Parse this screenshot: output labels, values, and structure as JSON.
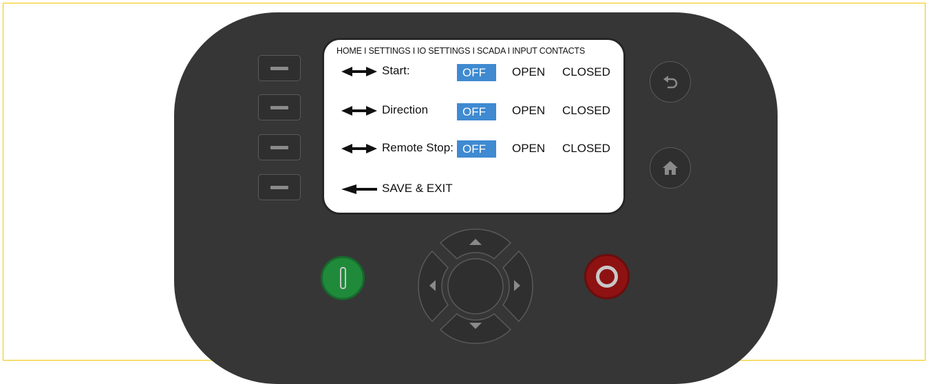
{
  "breadcrumb": "HOME I SETTINGS I IO SETTINGS I SCADA I INPUT CONTACTS",
  "rows": [
    {
      "label": "Start:",
      "options": [
        "OFF",
        "OPEN",
        "CLOSED"
      ],
      "selected": "OFF"
    },
    {
      "label": "Direction",
      "options": [
        "OFF",
        "OPEN",
        "CLOSED"
      ],
      "selected": "OFF"
    },
    {
      "label": "Remote Stop:",
      "options": [
        "OFF",
        "OPEN",
        "CLOSED"
      ],
      "selected": "OFF"
    }
  ],
  "save_exit": "SAVE & EXIT",
  "icons": {
    "back": "back-arrow-icon",
    "home": "home-icon",
    "start": "power-on-icon",
    "stop": "power-off-icon",
    "nav_up": "arrow-up-icon",
    "nav_down": "arrow-down-icon",
    "nav_left": "arrow-left-icon",
    "nav_right": "arrow-right-icon"
  },
  "colors": {
    "selected_option": "#3f8ad1",
    "start_button": "#1f8a3a",
    "stop_button": "#8e1212",
    "device_body": "#363636"
  }
}
